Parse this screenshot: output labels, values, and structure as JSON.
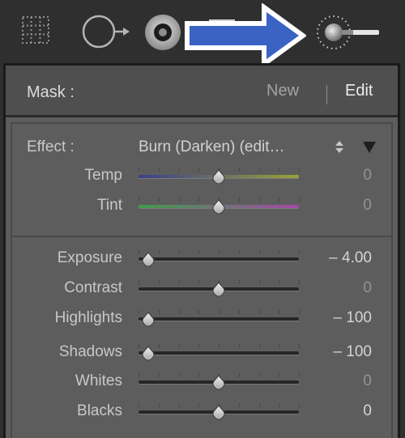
{
  "toolbar": {
    "tools": [
      {
        "icon": "crop-overlay-icon"
      },
      {
        "icon": "spot-removal-icon"
      },
      {
        "icon": "red-eye-icon"
      },
      {
        "icon": "graduated-filter-icon"
      },
      {
        "icon": "adjustment-brush-icon",
        "active": true
      }
    ],
    "annotation_arrow_color": "#3a63c4"
  },
  "mask": {
    "label": "Mask :",
    "new_label": "New",
    "edit_label": "Edit"
  },
  "effect": {
    "label": "Effect :",
    "value": "Burn (Darken) (edit…"
  },
  "color_sliders": [
    {
      "label": "Temp",
      "value": "0",
      "position": 0.5,
      "track": "temp"
    },
    {
      "label": "Tint",
      "value": "0",
      "position": 0.5,
      "track": "tint"
    }
  ],
  "tone_sliders": [
    {
      "label": "Exposure",
      "value": "– 4.00",
      "position": 0.06,
      "emphasis": true
    },
    {
      "label": "Contrast",
      "value": "0",
      "position": 0.5,
      "emphasis": false
    },
    {
      "label": "Highlights",
      "value": "– 100",
      "position": 0.06,
      "emphasis": true
    },
    {
      "label": "Shadows",
      "value": "– 100",
      "position": 0.06,
      "emphasis": true
    },
    {
      "label": "Whites",
      "value": "0",
      "position": 0.5,
      "emphasis": false
    },
    {
      "label": "Blacks",
      "value": "0",
      "position": 0.5,
      "emphasis": true
    }
  ],
  "colors": {
    "temp_track": [
      "#3b3f8f",
      "#9aa236"
    ],
    "tint_track": [
      "#3d9d4a",
      "#a648a8"
    ]
  }
}
